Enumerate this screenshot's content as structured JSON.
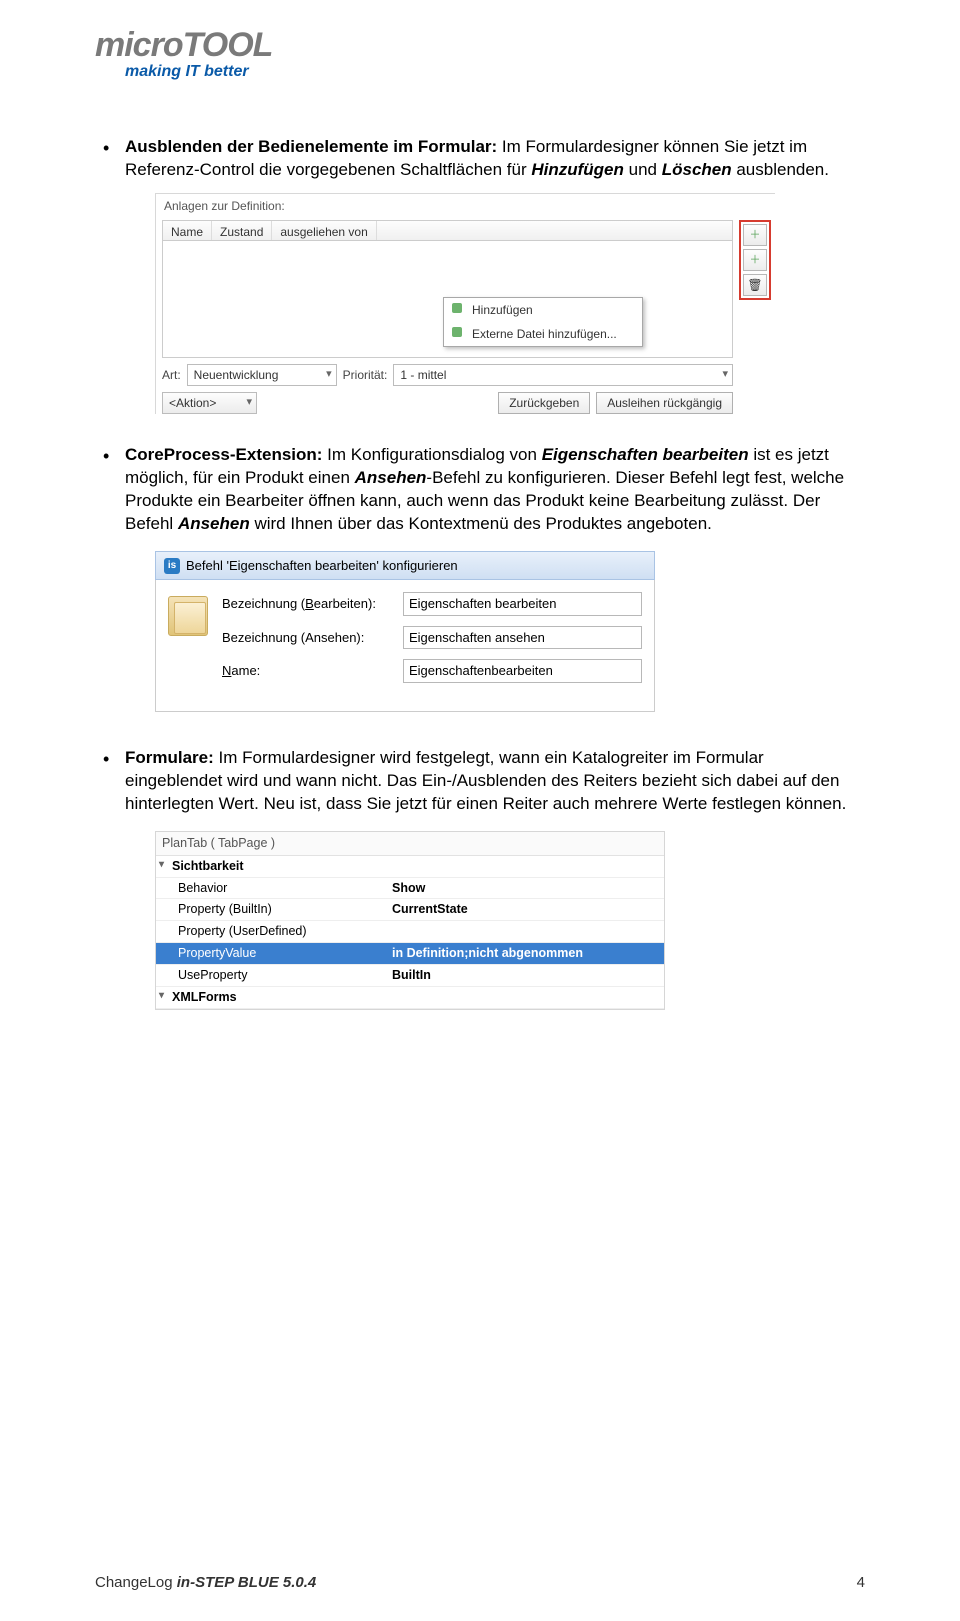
{
  "logo": {
    "part1": "micro",
    "part2": "TOOL",
    "tagline": "making IT better"
  },
  "bullets": {
    "b1": {
      "lead": "Ausblenden der Bedienelemente im Formular:",
      "rest": " Im Formulardesigner können Sie jetzt im Referenz-Control die vorgegebenen Schaltflächen für ",
      "hinz": "Hinzufügen",
      "und": " und ",
      "loesch": "Löschen",
      "tail": " ausblenden."
    },
    "b2": {
      "lead": "CoreProcess-Extension:",
      "p1": " Im Konfigurationsdialog von ",
      "eig": "Eigenschaften bearbeiten",
      "p2": " ist es jetzt möglich, für ein Produkt einen ",
      "ans": "Ansehen",
      "p3": "-Befehl zu konfigurieren. Dieser Befehl legt fest, welche Produkte ein Bearbeiter öffnen kann, auch wenn das Produkt keine Bearbeitung zulässt. Der Befehl ",
      "ans2": "Ansehen",
      "p4": " wird Ihnen über das Kontextmenü des Produktes angeboten."
    },
    "b3": {
      "lead": "Formulare:",
      "rest": " Im Formulardesigner wird festgelegt, wann ein Katalogreiter im Formular eingeblendet wird und wann nicht. Das Ein-/Ausblenden des Reiters bezieht sich dabei auf den hinterlegten Wert. Neu ist, dass Sie jetzt für einen Reiter auch mehrere Werte festlegen können."
    }
  },
  "fig1": {
    "title": "Anlagen zur Definition:",
    "cols": {
      "c1": "Name",
      "c2": "Zustand",
      "c3": "ausgeliehen von"
    },
    "menu": {
      "m1": "Hinzufügen",
      "m2": "Externe Datei hinzufügen..."
    },
    "art_label": "Art:",
    "art_value": "Neuentwicklung",
    "prio_label": "Priorität:",
    "prio_value": "1 - mittel",
    "aktion": "<Aktion>",
    "btn1": "Zurückgeben",
    "btn2": "Ausleihen rückgängig"
  },
  "fig2": {
    "title": "Befehl 'Eigenschaften bearbeiten' konfigurieren",
    "row1_label_pre": "Bezeichnung (",
    "row1_label_ul": "B",
    "row1_label_post": "earbeiten):",
    "row1_val": "Eigenschaften bearbeiten",
    "row2_label": "Bezeichnung (Ansehen):",
    "row2_val": "Eigenschaften ansehen",
    "row3_label_ul": "N",
    "row3_label_post": "ame:",
    "row3_val": "Eigenschaftenbearbeiten"
  },
  "fig3": {
    "hdr": "PlanTab ( TabPage )",
    "rows": [
      {
        "k": "Sichtbarkeit",
        "v": "",
        "cat": true
      },
      {
        "k": "Behavior",
        "v": "Show"
      },
      {
        "k": "Property (BuiltIn)",
        "v": "CurrentState"
      },
      {
        "k": "Property (UserDefined)",
        "v": ""
      },
      {
        "k": "PropertyValue",
        "v": "in Definition;nicht abgenommen",
        "sel": true
      },
      {
        "k": "UseProperty",
        "v": "BuiltIn"
      },
      {
        "k": "XMLForms",
        "v": "",
        "cat": true
      }
    ]
  },
  "footer": {
    "prefix": "ChangeLog ",
    "product": "in-STEP BLUE",
    "version": " 5.0.4",
    "page": "4"
  }
}
